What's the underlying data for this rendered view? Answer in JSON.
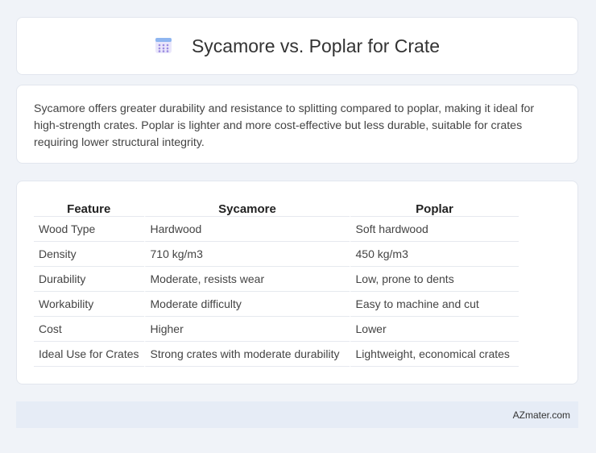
{
  "header": {
    "title": "Sycamore vs. Poplar for Crate",
    "icon": "calendar-icon"
  },
  "summary": {
    "text": "Sycamore offers greater durability and resistance to splitting compared to poplar, making it ideal for high-strength crates. Poplar is lighter and more cost-effective but less durable, suitable for crates requiring lower structural integrity."
  },
  "table": {
    "headers": [
      "Feature",
      "Sycamore",
      "Poplar"
    ],
    "rows": [
      [
        "Wood Type",
        "Hardwood",
        "Soft hardwood"
      ],
      [
        "Density",
        "710 kg/m3",
        "450 kg/m3"
      ],
      [
        "Durability",
        "Moderate, resists wear",
        "Low, prone to dents"
      ],
      [
        "Workability",
        "Moderate difficulty",
        "Easy to machine and cut"
      ],
      [
        "Cost",
        "Higher",
        "Lower"
      ],
      [
        "Ideal Use for Crates",
        "Strong crates with moderate durability",
        "Lightweight, economical crates"
      ]
    ]
  },
  "footer": {
    "brand": "AZmater.com"
  },
  "colors": {
    "background": "#f0f3f8",
    "footer_bg": "#e6ecf6",
    "icon_accent": "#7b6fd6"
  }
}
